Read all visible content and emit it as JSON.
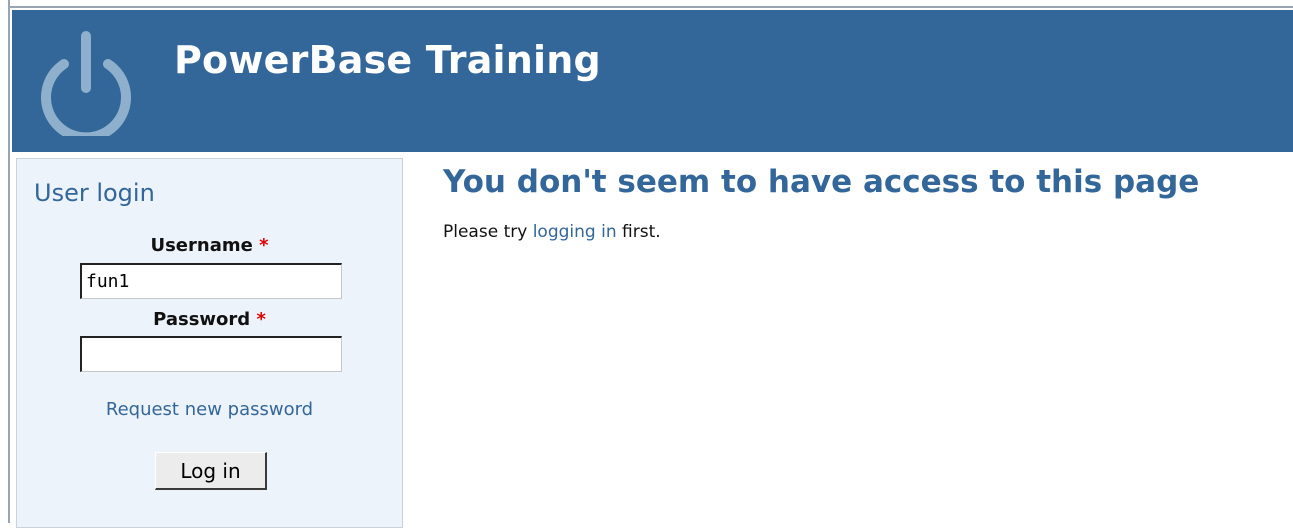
{
  "header": {
    "title": "PowerBase Training",
    "logo_icon": "power-icon"
  },
  "sidebar": {
    "block_title": "User login",
    "username_label": "Username",
    "password_label": "Password",
    "required_mark": "*",
    "username_value": "fun1",
    "password_value": "",
    "request_password_label": "Request new password",
    "login_button_label": "Log in"
  },
  "main": {
    "title": "You don't seem to have access to this page",
    "message_prefix": "Please try",
    "message_link": "logging in",
    "message_suffix": "first."
  },
  "colors": {
    "brand": "#336699",
    "sidebar_bg": "#edf3fa",
    "required": "#e00000"
  }
}
